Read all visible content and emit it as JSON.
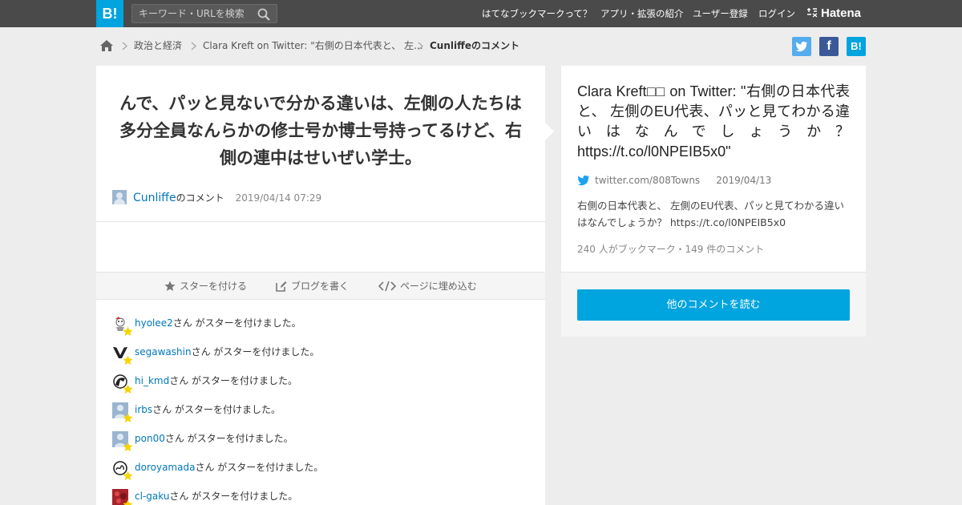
{
  "header": {
    "logo": "B!",
    "search_placeholder": "キーワード・URLを検索",
    "nav": [
      "はてなブックマークって？",
      "アプリ・拡張の紹介",
      "ユーザー登録",
      "ログイン"
    ],
    "brand": "Hatena"
  },
  "breadcrumb": {
    "items": [
      "政治と経済",
      "Clara Kreft on Twitter: \"右側の日本代表と、 左...",
      "Cunliffeのコメント"
    ]
  },
  "share": {
    "twitter": "t",
    "facebook": "f",
    "hatena": "B!"
  },
  "comment": {
    "text": "んで、パッと見ないで分かる違いは、左側の人たちは多分全員なんらかの修士号か博士号持ってるけど、右側の連中はせいぜい学士。",
    "author": "Cunliffe",
    "author_suffix": "のコメント",
    "datetime": "2019/04/14 07:29"
  },
  "actions": [
    "スターを付ける",
    "ブログを書く",
    "ページに埋め込む"
  ],
  "stars": [
    {
      "user": "hyolee2",
      "suffix": "さん がスターを付けました。"
    },
    {
      "user": "segawashin",
      "suffix": "さん がスターを付けました。"
    },
    {
      "user": "hi_kmd",
      "suffix": "さん がスターを付けました。"
    },
    {
      "user": "irbs",
      "suffix": "さん がスターを付けました。"
    },
    {
      "user": "pon00",
      "suffix": "さん がスターを付けました。"
    },
    {
      "user": "doroyamada",
      "suffix": "さん がスターを付けました。"
    },
    {
      "user": "cl-gaku",
      "suffix": "さん がスターを付けました。"
    }
  ],
  "entry": {
    "title": "Clara Kreft□□ on Twitter: \"右側の日本代表と、 左側のEU代表、パッと見てわかる違いはなんでしょうか？ https://t.co/l0NPEIB5x0\"",
    "source": "twitter.com/808Towns",
    "date": "2019/04/13",
    "summary": "右側の日本代表と、 左側のEU代表、パッと見てわかる違いはなんでしょうか？ https://t.co/l0NPEIB5x0",
    "counts": "240 人がブックマーク・149 件のコメント",
    "read_button": "他のコメントを読む"
  },
  "colors": {
    "accent": "#00a4de",
    "header_bg": "#4a4a4a",
    "link": "#0077bb",
    "star": "#f5d400"
  }
}
